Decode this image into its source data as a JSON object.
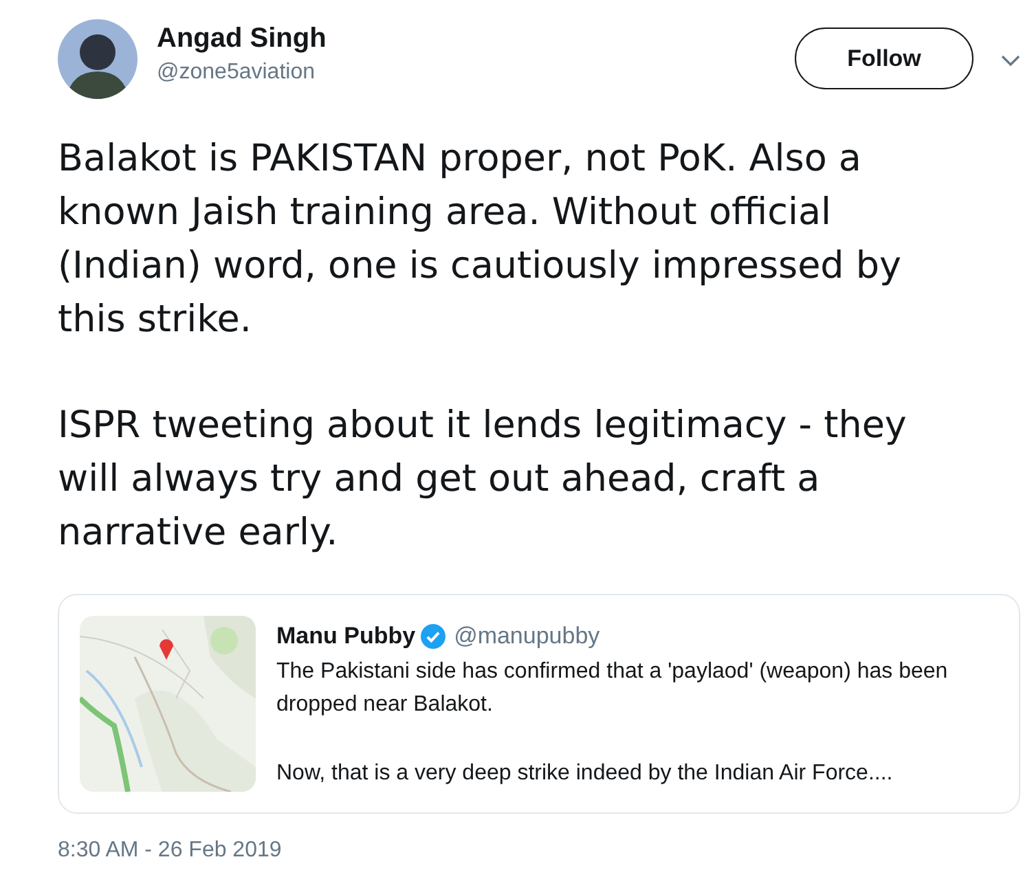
{
  "author": {
    "name": "Angad Singh",
    "handle": "@zone5aviation"
  },
  "follow_button": {
    "label": "Follow"
  },
  "paragraphs": [
    "Balakot is PAKISTAN proper, not PoK. Also a known Jaish training area. Without official (Indian) word, one is cautiously impressed by this strike.",
    "ISPR tweeting about it lends legitimacy - they will always try and get out ahead, craft a narrative early."
  ],
  "quoted_tweet": {
    "name": "Manu Pubby",
    "verified": true,
    "handle": "@manupubby",
    "paragraphs": [
      "The Pakistani side has confirmed that a 'paylaod' (weapon) has been dropped near Balakot.",
      "Now, that is a very deep strike indeed by the Indian Air Force...."
    ]
  },
  "timestamp": "8:30 AM - 26 Feb 2019"
}
